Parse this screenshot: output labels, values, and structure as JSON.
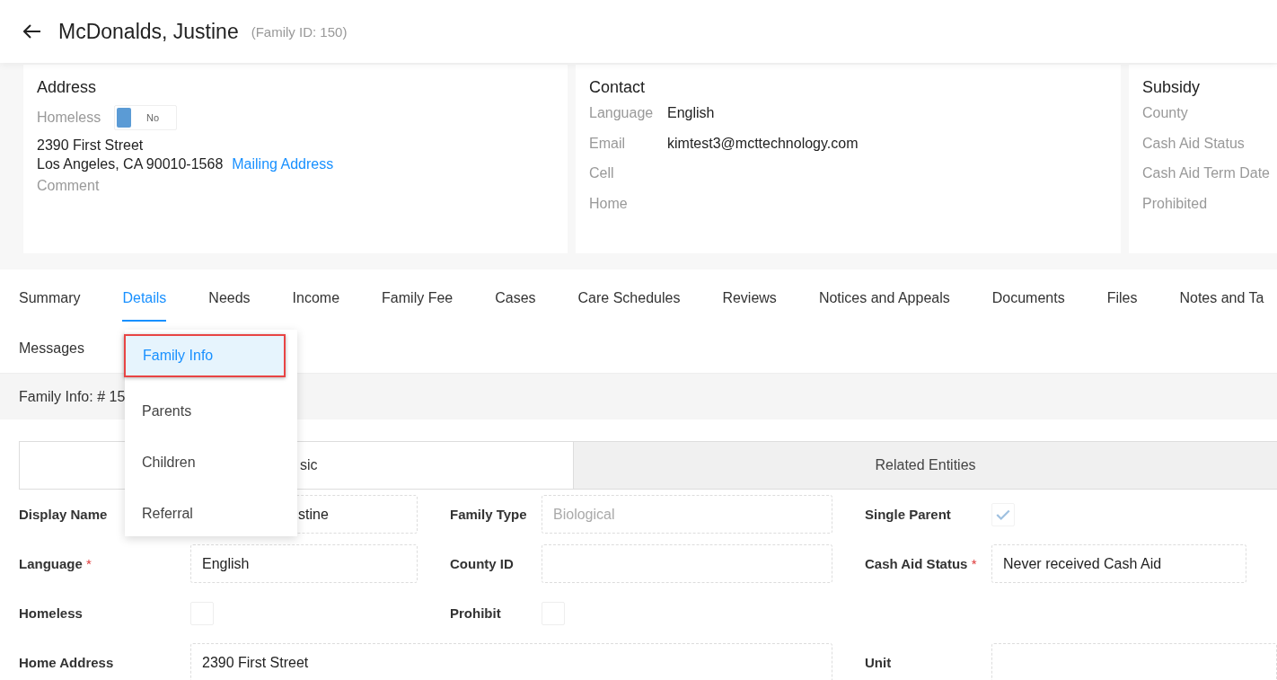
{
  "header": {
    "title": "McDonalds, Justine",
    "family_id": "(Family ID: 150)"
  },
  "address_card": {
    "title": "Address",
    "homeless_label": "Homeless",
    "homeless_toggle": {
      "label": "No",
      "on": false
    },
    "street": "2390 First Street",
    "city_line": "Los Angeles, CA 90010-1568",
    "mailing_link": "Mailing Address",
    "comment_label": "Comment"
  },
  "contact_card": {
    "title": "Contact",
    "fields": [
      {
        "label": "Language",
        "value": "English"
      },
      {
        "label": "Email",
        "value": "kimtest3@mcttechnology.com"
      },
      {
        "label": "Cell"
      },
      {
        "label": "Home"
      }
    ]
  },
  "subsidy_card": {
    "title": "Subsidy",
    "fields": [
      "County",
      "Cash Aid Status",
      "Cash Aid Term Date",
      "Prohibited"
    ]
  },
  "tabs": [
    {
      "label": "Summary",
      "selected": false
    },
    {
      "label": "Details",
      "selected": true
    },
    {
      "label": "Needs",
      "selected": false
    },
    {
      "label": "Income",
      "selected": false
    },
    {
      "label": "Family Fee",
      "selected": false
    },
    {
      "label": "Cases",
      "selected": false
    },
    {
      "label": "Care Schedules",
      "selected": false
    },
    {
      "label": "Reviews",
      "selected": false
    },
    {
      "label": "Notices and Appeals",
      "selected": false
    },
    {
      "label": "Documents",
      "selected": false
    },
    {
      "label": "Files",
      "selected": false
    },
    {
      "label": "Notes and Ta",
      "selected": false
    },
    {
      "label": "Messages",
      "selected": false
    }
  ],
  "dropdown": {
    "items": [
      {
        "label": "Family Info",
        "selected": true
      },
      {
        "label": "Parents",
        "selected": false
      },
      {
        "label": "Children",
        "selected": false
      },
      {
        "label": "Referral",
        "selected": false
      }
    ]
  },
  "section_bar": {
    "title": "Family Info: # 15"
  },
  "sub_tabs": [
    {
      "label": "sic",
      "selected": true
    },
    {
      "label": "Related Entities",
      "selected": false
    }
  ],
  "form": {
    "rows": [
      [
        {
          "label": "Display Name",
          "kind": "input",
          "value": "stine"
        },
        {
          "label": "Family Type",
          "kind": "input",
          "value": "Biological",
          "disabled": true
        },
        {
          "label": "Single Parent",
          "kind": "checkbox",
          "checked": true
        }
      ],
      [
        {
          "label": "Language",
          "mark": "*",
          "kind": "input",
          "value": "English"
        },
        {
          "label": "County ID",
          "kind": "input"
        },
        {
          "label": "Cash Aid Status",
          "mark": "*",
          "kind": "input",
          "value": "Never received Cash Aid"
        }
      ],
      [
        {
          "label": "Homeless",
          "kind": "checkbox",
          "checked": false
        },
        {
          "label": "Prohibit",
          "kind": "checkbox",
          "checked": false
        }
      ],
      [
        {
          "label": "Home Address",
          "kind": "wide_input",
          "value": "2390 First Street"
        },
        "",
        {
          "label": "Unit",
          "kind": "wide_input"
        }
      ]
    ]
  }
}
